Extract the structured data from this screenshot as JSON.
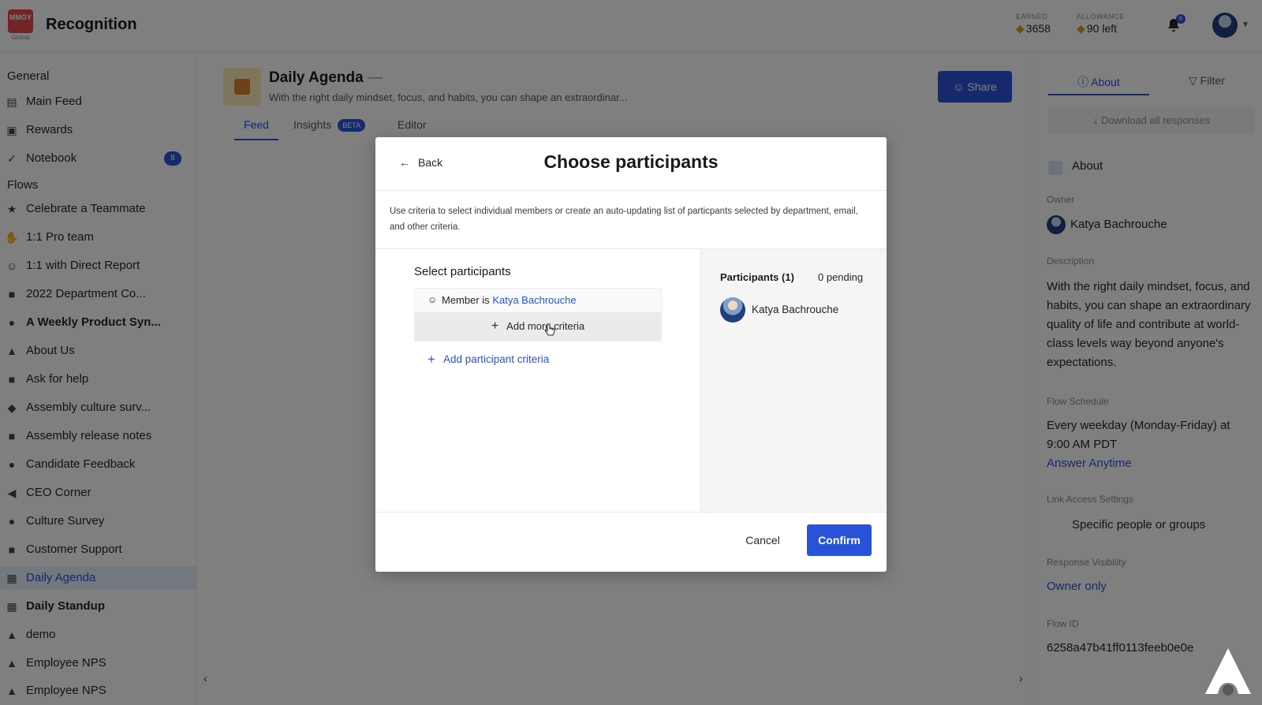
{
  "app": {
    "title": "Recognition",
    "logo_text": "MMGY",
    "logo_sub": "Global",
    "earned_label": "EARNED",
    "earned_value": "3658",
    "allowance_label": "ALLOWANCE",
    "allowance_value": "90 left",
    "notification_count": "6"
  },
  "sidebar": {
    "general_label": "General",
    "general_items": [
      {
        "label": "Main Feed"
      },
      {
        "label": "Rewards"
      },
      {
        "label": "Notebook",
        "badge": "8"
      }
    ],
    "flows_label": "Flows",
    "flows": [
      {
        "label": "Celebrate a Teammate"
      },
      {
        "label": "1:1 Pro team"
      },
      {
        "label": "1:1 with Direct Report"
      },
      {
        "label": "2022 Department Co..."
      },
      {
        "label": "A Weekly Product Syn..."
      },
      {
        "label": "About Us"
      },
      {
        "label": "Ask for help"
      },
      {
        "label": "Assembly culture surv..."
      },
      {
        "label": "Assembly release notes"
      },
      {
        "label": "Candidate Feedback"
      },
      {
        "label": "CEO Corner"
      },
      {
        "label": "Culture Survey"
      },
      {
        "label": "Customer Support"
      },
      {
        "label": "Daily Agenda"
      },
      {
        "label": "Daily Standup"
      },
      {
        "label": "demo"
      },
      {
        "label": "Employee NPS"
      },
      {
        "label": "Employee NPS"
      }
    ]
  },
  "flow": {
    "title": "Daily Agenda",
    "title_suffix": "—",
    "description": "With the right daily mindset, focus, and habits, you can shape an extraordinar...",
    "share_label": "Share",
    "tabs": {
      "feed": "Feed",
      "insights": "Insights",
      "insights_badge": "BETA",
      "editor": "Editor"
    }
  },
  "right_panel": {
    "tab_about": "About",
    "tab_filter": "Filter",
    "download": "Download all responses",
    "about_title": "About",
    "owner_label": "Owner",
    "owner_value": "Katya Bachrouche",
    "description_label": "Description",
    "description_value": "With the right daily mindset, focus, and habits, you can shape an extraordinary quality of life and contribute at world-class levels way beyond anyone's expectations.",
    "schedule_label": "Flow Schedule",
    "schedule_value": "Every weekday (Monday-Friday) at 9:00 AM PDT",
    "schedule_link": "Answer Anytime",
    "access_label": "Link Access Settings",
    "access_value": "Specific people or groups",
    "visibility_label": "Response Visibility",
    "visibility_value": "Owner only",
    "flowid_label": "Flow ID",
    "flowid_value": "6258a47b41ff0113feeb0e0e"
  },
  "modal": {
    "back_label": "Back",
    "title": "Choose participants",
    "description": "Use criteria to select individual members or create an auto-updating list of particpants selected by department, email, and other criteria.",
    "select_title": "Select participants",
    "criteria_prefix": "Member is",
    "criteria_member": "Katya Bachrouche",
    "add_more_label": "Add more criteria",
    "add_criteria_label": "Add participant criteria",
    "participants_label": "Participants (1)",
    "pending_label": "0 pending",
    "participant_name": "Katya Bachrouche",
    "cancel_label": "Cancel",
    "confirm_label": "Confirm"
  },
  "colors": {
    "accent": "#2a52d8",
    "overlay": "rgba(0,0,0,0.5)"
  }
}
